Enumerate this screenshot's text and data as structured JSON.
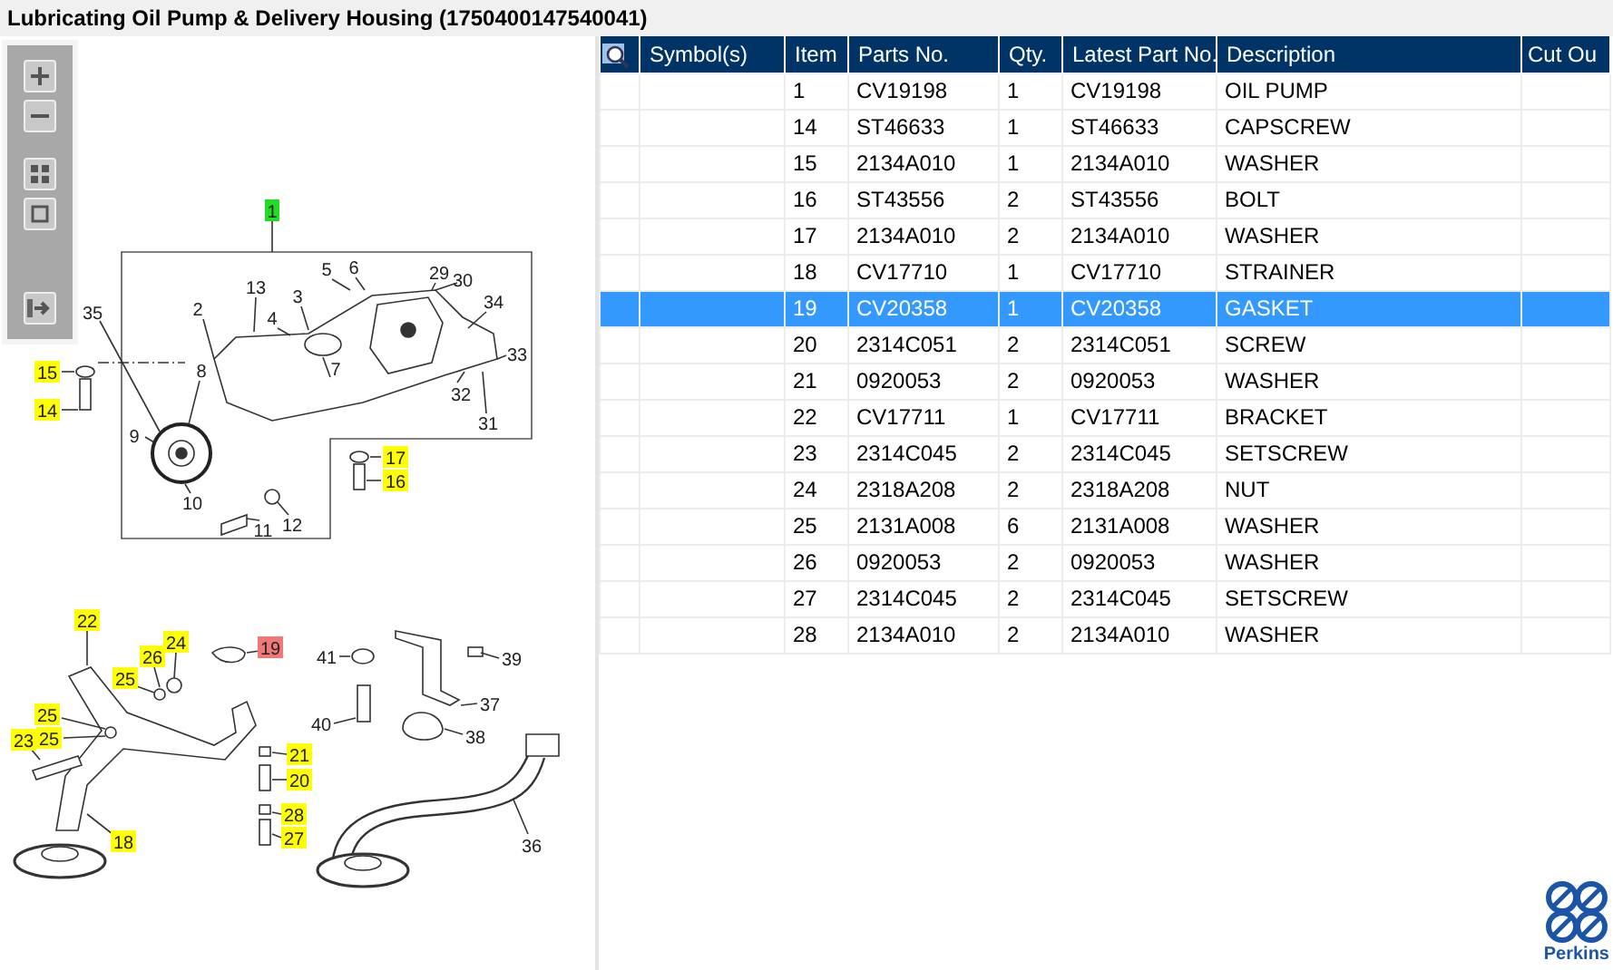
{
  "title": "Lubricating Oil Pump & Delivery Housing (1750400147540041)",
  "toolbar": {
    "buttons": [
      {
        "kind": "zoom_in"
      },
      {
        "kind": "zoom_out"
      },
      {
        "kind": "grid"
      },
      {
        "kind": "fit"
      },
      {
        "kind": "exit"
      }
    ]
  },
  "diagram": {
    "callouts": [
      {
        "label": "1",
        "color": "#22dd22"
      },
      {
        "label": "5"
      },
      {
        "label": "6"
      },
      {
        "label": "29"
      },
      {
        "label": "30"
      },
      {
        "label": "13"
      },
      {
        "label": "3"
      },
      {
        "label": "34"
      },
      {
        "label": "35"
      },
      {
        "label": "2"
      },
      {
        "label": "4"
      },
      {
        "label": "33"
      },
      {
        "label": "15",
        "color": "#ffff00"
      },
      {
        "label": "8"
      },
      {
        "label": "7"
      },
      {
        "label": "32"
      },
      {
        "label": "14",
        "color": "#ffff00"
      },
      {
        "label": "9"
      },
      {
        "label": "31"
      },
      {
        "label": "17",
        "color": "#ffff00"
      },
      {
        "label": "16",
        "color": "#ffff00"
      },
      {
        "label": "10"
      },
      {
        "label": "11"
      },
      {
        "label": "12"
      },
      {
        "label": "22",
        "color": "#ffff00"
      },
      {
        "label": "26",
        "color": "#ffff00"
      },
      {
        "label": "24",
        "color": "#ffff00"
      },
      {
        "label": "19",
        "color": "#f07878"
      },
      {
        "label": "41"
      },
      {
        "label": "39"
      },
      {
        "label": "25",
        "color": "#ffff00"
      },
      {
        "label": "25",
        "color": "#ffff00"
      },
      {
        "label": "37"
      },
      {
        "label": "40"
      },
      {
        "label": "23",
        "color": "#ffff00"
      },
      {
        "label": "25",
        "color": "#ffff00"
      },
      {
        "label": "38"
      },
      {
        "label": "21",
        "color": "#ffff00"
      },
      {
        "label": "20",
        "color": "#ffff00"
      },
      {
        "label": "28",
        "color": "#ffff00"
      },
      {
        "label": "18",
        "color": "#ffff00"
      },
      {
        "label": "27",
        "color": "#ffff00"
      },
      {
        "label": "36"
      }
    ]
  },
  "table": {
    "columns": [
      "Symbol(s)",
      "Item",
      "Parts No.",
      "Qty.",
      "Latest Part No.",
      "Description",
      "Cut Ou"
    ],
    "rows": [
      {
        "item": "1",
        "parts_no": "CV19198",
        "qty": "1",
        "latest_part_no": "CV19198",
        "description": "OIL PUMP",
        "selected": false
      },
      {
        "item": "14",
        "parts_no": "ST46633",
        "qty": "1",
        "latest_part_no": "ST46633",
        "description": "CAPSCREW",
        "selected": false
      },
      {
        "item": "15",
        "parts_no": "2134A010",
        "qty": "1",
        "latest_part_no": "2134A010",
        "description": "WASHER",
        "selected": false
      },
      {
        "item": "16",
        "parts_no": "ST43556",
        "qty": "2",
        "latest_part_no": "ST43556",
        "description": "BOLT",
        "selected": false
      },
      {
        "item": "17",
        "parts_no": "2134A010",
        "qty": "2",
        "latest_part_no": "2134A010",
        "description": "WASHER",
        "selected": false
      },
      {
        "item": "18",
        "parts_no": "CV17710",
        "qty": "1",
        "latest_part_no": "CV17710",
        "description": "STRAINER",
        "selected": false
      },
      {
        "item": "19",
        "parts_no": "CV20358",
        "qty": "1",
        "latest_part_no": "CV20358",
        "description": "GASKET",
        "selected": true
      },
      {
        "item": "20",
        "parts_no": "2314C051",
        "qty": "2",
        "latest_part_no": "2314C051",
        "description": "SCREW",
        "selected": false
      },
      {
        "item": "21",
        "parts_no": "0920053",
        "qty": "2",
        "latest_part_no": "0920053",
        "description": "WASHER",
        "selected": false
      },
      {
        "item": "22",
        "parts_no": "CV17711",
        "qty": "1",
        "latest_part_no": "CV17711",
        "description": "BRACKET",
        "selected": false
      },
      {
        "item": "23",
        "parts_no": "2314C045",
        "qty": "2",
        "latest_part_no": "2314C045",
        "description": "SETSCREW",
        "selected": false
      },
      {
        "item": "24",
        "parts_no": "2318A208",
        "qty": "2",
        "latest_part_no": "2318A208",
        "description": "NUT",
        "selected": false
      },
      {
        "item": "25",
        "parts_no": "2131A008",
        "qty": "6",
        "latest_part_no": "2131A008",
        "description": "WASHER",
        "selected": false
      },
      {
        "item": "26",
        "parts_no": "0920053",
        "qty": "2",
        "latest_part_no": "0920053",
        "description": "WASHER",
        "selected": false
      },
      {
        "item": "27",
        "parts_no": "2314C045",
        "qty": "2",
        "latest_part_no": "2314C045",
        "description": "SETSCREW",
        "selected": false
      },
      {
        "item": "28",
        "parts_no": "2134A010",
        "qty": "2",
        "latest_part_no": "2134A010",
        "description": "WASHER",
        "selected": false
      }
    ]
  },
  "logo": {
    "text": "Perkins"
  }
}
